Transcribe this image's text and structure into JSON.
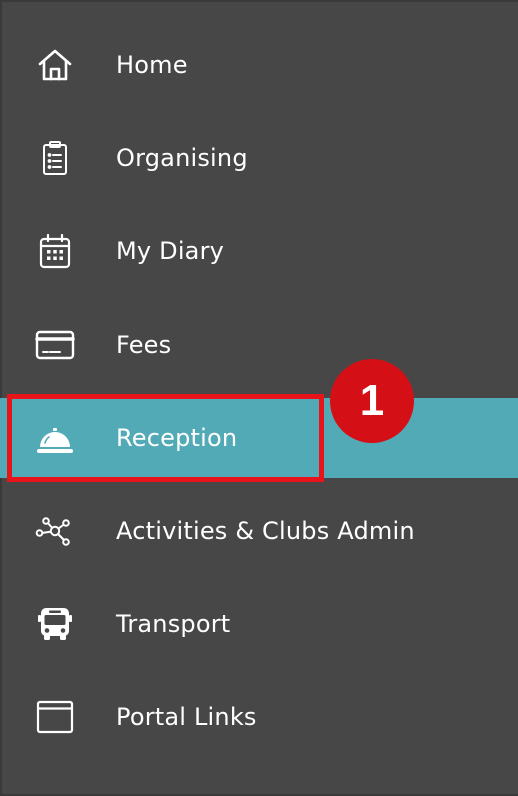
{
  "nav": {
    "items": [
      {
        "label": "Home",
        "icon": "home-icon"
      },
      {
        "label": "Organising",
        "icon": "clipboard-list-icon"
      },
      {
        "label": "My Diary",
        "icon": "calendar-icon"
      },
      {
        "label": "Fees",
        "icon": "credit-card-icon"
      },
      {
        "label": "Reception",
        "icon": "reception-bell-icon",
        "active": true
      },
      {
        "label": "Activities & Clubs Admin",
        "icon": "network-nodes-icon"
      },
      {
        "label": "Transport",
        "icon": "bus-icon"
      },
      {
        "label": "Portal Links",
        "icon": "browser-window-icon"
      }
    ]
  },
  "annotation": {
    "step_number": "1"
  },
  "colors": {
    "sidebar_background": "#474747",
    "active_background": "#52aab6",
    "highlight_border": "#e8141a",
    "badge_background": "#d50f16",
    "text": "#ffffff"
  }
}
